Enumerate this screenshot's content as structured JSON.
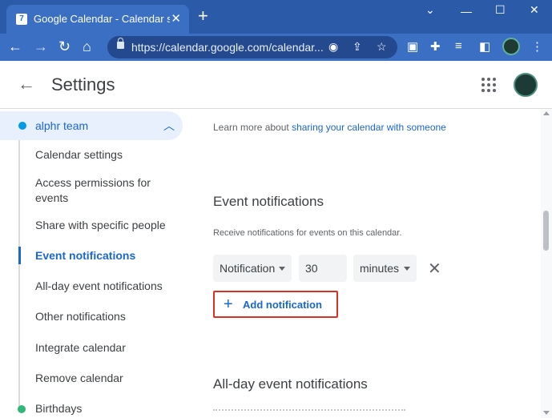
{
  "browser": {
    "tab_title": "Google Calendar - Calendar settings",
    "tab_favicon_text": "7",
    "url": "https://calendar.google.com/calendar...",
    "new_tab_symbol": "+",
    "icons": [
      "back-icon",
      "forward-icon",
      "reload-icon",
      "home-icon",
      "lock-icon",
      "eye-icon",
      "share-icon",
      "star-icon",
      "extensions-icon",
      "puzzle-icon",
      "reading-list-icon",
      "sidepanel-icon",
      "profile-avatar",
      "menu-icon"
    ]
  },
  "app": {
    "title": "Settings",
    "icons": [
      "back-arrow-icon",
      "apps-grid-icon",
      "account-avatar"
    ]
  },
  "sidebar": {
    "calendar_name": "alphr team",
    "calendar_color": "#039be5",
    "items": [
      {
        "label": "Calendar settings"
      },
      {
        "label": "Access permissions for events"
      },
      {
        "label": "Share with specific people"
      },
      {
        "label": "Event notifications",
        "active": true
      },
      {
        "label": "All-day event notifications"
      },
      {
        "label": "Other notifications"
      },
      {
        "label": "Integrate calendar"
      },
      {
        "label": "Remove calendar"
      }
    ],
    "next_calendar": {
      "name": "Birthdays",
      "color": "#33b679"
    }
  },
  "main": {
    "learn_more_prefix": "Learn more about ",
    "learn_more_link": "sharing your calendar with someone",
    "event_notifications": {
      "title": "Event notifications",
      "description": "Receive notifications for events on this calendar.",
      "type_value": "Notification",
      "amount_value": "30",
      "unit_value": "minutes",
      "add_label": "Add notification"
    },
    "allday_title": "All-day event notifications"
  },
  "colors": {
    "accent": "#1967d2",
    "highlight_border": "#d93025",
    "browser_frame": "#2b5aa8"
  }
}
